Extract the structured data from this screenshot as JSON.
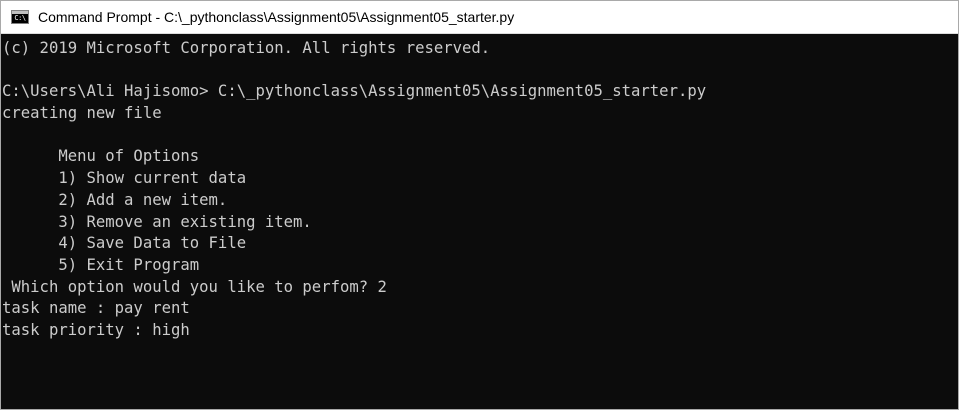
{
  "window": {
    "title": "Command Prompt - C:\\_pythonclass\\Assignment05\\Assignment05_starter.py",
    "icon": "console-app-icon",
    "icon_glyph": "C:\\"
  },
  "console": {
    "lines": [
      "(c) 2019 Microsoft Corporation. All rights reserved.",
      "",
      "C:\\Users\\Ali Hajisomo> C:\\_pythonclass\\Assignment05\\Assignment05_starter.py",
      "creating new file",
      "",
      "      Menu of Options",
      "      1) Show current data",
      "      2) Add a new item.",
      "      3) Remove an existing item.",
      "      4) Save Data to File",
      "      5) Exit Program",
      " Which option would you like to perfom? 2",
      "task name : pay rent",
      "task priority : high"
    ]
  },
  "colors": {
    "console_background": "#0c0c0c",
    "console_text": "#cccccc",
    "titlebar_background": "#ffffff"
  }
}
